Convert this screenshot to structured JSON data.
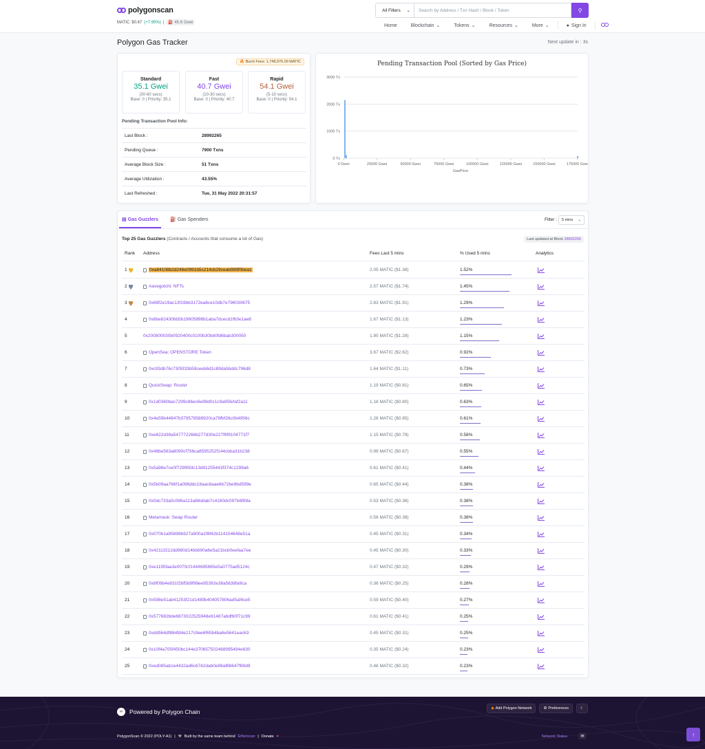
{
  "brand": {
    "name": "polygonscan",
    "accent": "#8247e5"
  },
  "ticker": {
    "matic_label": "MATIC",
    "price": "$0.67",
    "change": "(+7.95%)",
    "gas": "45.6 Gwei"
  },
  "search": {
    "filter": "All Filters",
    "placeholder": "Search by Address / Txn Hash / Block / Token"
  },
  "nav": {
    "home": "Home",
    "blockchain": "Blockchain",
    "tokens": "Tokens",
    "resources": "Resources",
    "more": "More",
    "signin": "Sign In"
  },
  "page": {
    "title": "Polygon Gas Tracker",
    "next_update": "Next update in : 3s"
  },
  "gas": {
    "burnt": "Burnt Fees: 1,748,975.09 MATIC",
    "tiers": [
      {
        "name": "Standard",
        "gwei": "35.1 Gwei",
        "time": "(30-60 secs)",
        "base": "Base: 0 | Priority: 35.1",
        "color": "#00a186"
      },
      {
        "name": "Fast",
        "gwei": "40.7 Gwei",
        "time": "(10-30 secs)",
        "base": "Base: 0 | Priority: 40.7",
        "color": "#8247e5"
      },
      {
        "name": "Rapid",
        "gwei": "54.1 Gwei",
        "time": "(5-10 secs)",
        "base": "Base: 0 | Priority: 54.1",
        "color": "#b85c3c"
      }
    ],
    "pool_title": "Pending Transaction Pool Info:",
    "pool": [
      {
        "k": "Last Block :",
        "v": "28992265"
      },
      {
        "k": "Pending Queue :",
        "v": "7900 Txns"
      },
      {
        "k": "Average Block Size :",
        "v": "51 Txns"
      },
      {
        "k": "Average Utilization :",
        "v": "43.55%"
      },
      {
        "k": "Last Refreshed :",
        "v": "Tue, 31 May 2022 20:31:57"
      }
    ]
  },
  "chart_data": {
    "type": "bar",
    "title": "Pending Transaction Pool (Sorted by Gas Price)",
    "xlabel": "GasPrice",
    "ylabel": "",
    "x_ticks": [
      "0 Gwei",
      "25000 Gwei",
      "50000 Gwei",
      "75000 Gwei",
      "100000 Gwei",
      "125000 Gwei",
      "150000 Gwei",
      "175000 Gwei"
    ],
    "y_ticks": [
      "0 Tx",
      "1000 Tx",
      "2000 Tx",
      "3000 Tx"
    ],
    "xlim": [
      0,
      175000
    ],
    "ylim": [
      0,
      3000
    ],
    "grid": true,
    "points": [
      {
        "x": 1000,
        "y": 2150
      },
      {
        "x": 2000,
        "y": 120
      },
      {
        "x": 175000,
        "y": 80
      }
    ],
    "color": "#7cb5ec"
  },
  "guzzlers": {
    "tab_active": "Gas Guzzlers",
    "tab_other": "Gas Spenders",
    "filter_label": "Filter :",
    "filter_value": "5 mins",
    "heading_bold": "Top 25 Gas Guzzlers",
    "heading_rest": " (Contracts / Accounts that consume a lot of Gas)",
    "last_updated_prefix": "Last updated at Block ",
    "last_updated_block": "28992260",
    "columns": [
      "Rank",
      "Address",
      "Fees Last 5 mins",
      "% Used 5 mins",
      "Analytics"
    ],
    "rows": [
      {
        "rank": "1",
        "address": "0xa84108b2d246e0991b5c214cb29ceab989f0bea1",
        "fee": "2.05 MATIC ($1.38)",
        "used": "1.52%",
        "pct": 1.52,
        "medal": "gold",
        "contract": true,
        "highlight": true
      },
      {
        "rank": "2",
        "address": "Aavegotchi: NFTs",
        "fee": "2.57 MATIC ($1.74)",
        "used": "1.45%",
        "pct": 1.45,
        "medal": "silver",
        "contract": true
      },
      {
        "rank": "3",
        "address": "0x68f2e19ac13f19bb3172ea6ce10db7e796030675",
        "fee": "2.83 MATIC ($1.91)",
        "used": "1.29%",
        "pct": 1.29,
        "medal": "bronze",
        "contract": true
      },
      {
        "rank": "4",
        "address": "0x8be82430bb5b19605898b1aba7dcecd1f63e1ae8",
        "fee": "1.67 MATIC ($1.13)",
        "used": "1.23%",
        "pct": 1.23,
        "contract": true
      },
      {
        "rank": "5",
        "address": "0x200800030b0920400c0100b30bb0fd6bab300050",
        "fee": "1.90 MATIC ($1.28)",
        "used": "1.15%",
        "pct": 1.15,
        "contract": false
      },
      {
        "rank": "6",
        "address": "OpenSea: OPENSTORE Token",
        "fee": "3.67 MATIC ($2.62)",
        "used": "0.92%",
        "pct": 0.92,
        "contract": true
      },
      {
        "rank": "7",
        "address": "0xc93db76c7305f33b59ceeb6d1c89da5bddc796d8",
        "fee": "1.64 MATIC ($1.11)",
        "used": "0.73%",
        "pct": 0.73,
        "contract": true
      },
      {
        "rank": "8",
        "address": "QuickSwap: Router",
        "fee": "1.19 MATIC ($0.81)",
        "used": "0.65%",
        "pct": 0.65,
        "contract": true
      },
      {
        "rank": "9",
        "address": "0x1d0360bac7299c86ec6e99d0c1c9a95fefaf2a11",
        "fee": "1.18 MATIC ($0.80)",
        "used": "0.63%",
        "pct": 0.63,
        "contract": true
      },
      {
        "rank": "10",
        "address": "0x4e59b44847b379578588920ca78fbf26c0b4956c",
        "fee": "1.26 MATIC ($0.85)",
        "used": "0.61%",
        "pct": 0.61,
        "contract": true
      },
      {
        "rank": "11",
        "address": "0xe622d39a547772266b277d30e227f9f9104771f7",
        "fee": "1.15 MATIC ($0.78)",
        "used": "0.58%",
        "pct": 0.58,
        "contract": true
      },
      {
        "rank": "12",
        "address": "0x48be563a8090cf756ca8595252f144cbba31b238",
        "fee": "0.99 MATIC ($0.67)",
        "used": "0.55%",
        "pct": 0.55,
        "contract": true
      },
      {
        "rank": "13",
        "address": "0x5a98e7ce0f72995fdc13d91255443f374c1299a6",
        "fee": "0.61 MATIC ($0.41)",
        "used": "0.44%",
        "pct": 0.44,
        "contract": true
      },
      {
        "rank": "14",
        "address": "0x5b09aa766f1a096ddc18aac6aae6b72be9bd599e",
        "fee": "0.65 MATIC ($0.44)",
        "used": "0.38%",
        "pct": 0.38,
        "contract": true
      },
      {
        "rank": "15",
        "address": "0x0dc733a0c086a113a88ddab7c4160dc097b6f89a",
        "fee": "0.53 MATIC ($0.36)",
        "used": "0.38%",
        "pct": 0.38,
        "contract": true
      },
      {
        "rank": "16",
        "address": "Metamask: Swap Router",
        "fee": "0.56 MATIC ($0.38)",
        "used": "0.38%",
        "pct": 0.38,
        "contract": true
      },
      {
        "rank": "17",
        "address": "0x070b1a95898b927a900a1f8f42b114154648e51a",
        "fee": "0.45 MATIC ($0.31)",
        "used": "0.34%",
        "pct": 0.34,
        "contract": true
      },
      {
        "rank": "18",
        "address": "0x42111512dd980d14bb690a6e5a21bcb0eefaa7ee",
        "fee": "0.45 MATIC ($0.30)",
        "used": "0.33%",
        "pct": 0.33,
        "contract": true
      },
      {
        "rank": "19",
        "address": "0xe1195faa3e0070cf1444685865e5a0775ad5124c",
        "fee": "0.47 MATIC ($0.32)",
        "used": "0.29%",
        "pct": 0.29,
        "contract": true
      },
      {
        "rank": "20",
        "address": "0x8f09b4e831f2bf5b9f98ee95392e38a5638fa9ca",
        "fee": "0.36 MATIC ($0.25)",
        "used": "0.28%",
        "pct": 0.28,
        "contract": true
      },
      {
        "rank": "21",
        "address": "0x598e51ab41253f21d1489b404057806ad5af4ce5",
        "fee": "0.59 MATIC ($0.40)",
        "used": "0.27%",
        "pct": 0.27,
        "contract": true
      },
      {
        "rank": "22",
        "address": "0x577682bde6873022525948e91487abdf60f71c99",
        "fee": "0.61 MATIC ($0.41)",
        "used": "0.25%",
        "pct": 0.25,
        "contract": true
      },
      {
        "rank": "23",
        "address": "0xdd564df884fd4e217c9ee6f65b4ba6e5641eac63",
        "fee": "0.45 MATIC ($0.31)",
        "used": "0.25%",
        "pct": 0.25,
        "contract": true
      },
      {
        "rank": "24",
        "address": "0x10f4a705f450bc144e370657502468995494e630",
        "fee": "0.35 MATIC ($0.24)",
        "used": "0.23%",
        "pct": 0.23,
        "contract": true
      },
      {
        "rank": "25",
        "address": "0xed085ab1e4432ad6c6742dab0e88af88647f89d9",
        "fee": "0.48 MATIC ($0.32)",
        "used": "0.23%",
        "pct": 0.23,
        "contract": true
      }
    ]
  },
  "footer": {
    "powered": "Powered by Polygon Chain",
    "add_network": "Add Polygon Network",
    "preferences": "Preferences",
    "copyright": "PolygonScan © 2022 (POLY-A1)",
    "built_by": "Built by the same team behind",
    "etherscan": "Etherscan",
    "donate": "Donate",
    "network_status": "Network Status"
  }
}
